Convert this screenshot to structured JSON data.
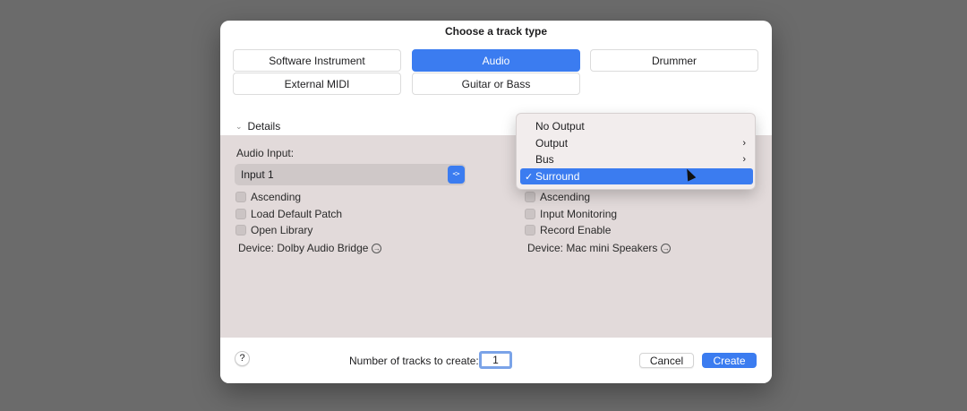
{
  "dialog": {
    "title": "Choose a track type",
    "track_types": [
      {
        "label": "Software Instrument",
        "selected": false
      },
      {
        "label": "Audio",
        "selected": true
      },
      {
        "label": "Drummer",
        "selected": false
      },
      {
        "label": "External MIDI",
        "selected": false
      },
      {
        "label": "Guitar or Bass",
        "selected": false
      }
    ],
    "details_label": "Details",
    "left": {
      "audio_input_label": "Audio Input:",
      "audio_input_value": "Input 1",
      "checkboxes": [
        "Ascending",
        "Load Default Patch",
        "Open Library"
      ],
      "device": "Device: Dolby Audio Bridge"
    },
    "right": {
      "checkboxes": [
        "Ascending",
        "Input Monitoring",
        "Record Enable"
      ],
      "device": "Device: Mac mini Speakers"
    },
    "footer": {
      "help": "?",
      "num_tracks_label": "Number of tracks to create:",
      "num_tracks_value": "1",
      "cancel": "Cancel",
      "create": "Create"
    }
  },
  "output_menu": {
    "items": [
      {
        "label": "No Output",
        "submenu": false,
        "selected": false
      },
      {
        "label": "Output",
        "submenu": true,
        "selected": false
      },
      {
        "label": "Bus",
        "submenu": true,
        "selected": false
      },
      {
        "label": "Surround",
        "submenu": false,
        "selected": true
      }
    ],
    "check": "✓"
  },
  "colors": {
    "accent": "#3b7cf0",
    "details_bg": "#e2dada",
    "backdrop": "#6b6b6b"
  }
}
